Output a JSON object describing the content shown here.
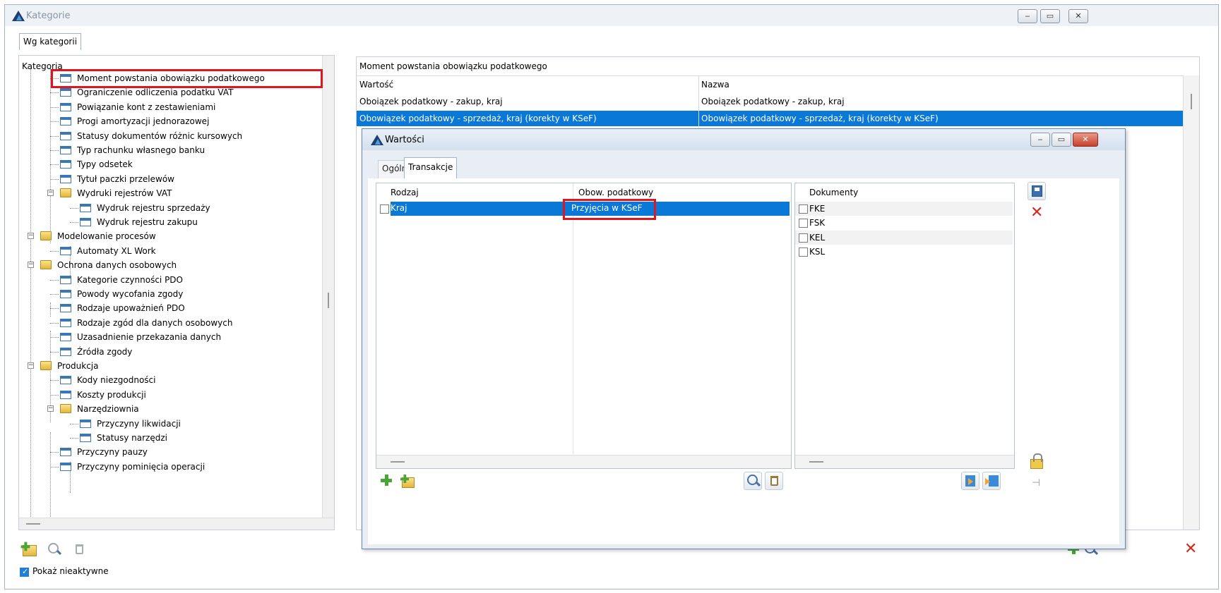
{
  "window": {
    "title": "Kategorie",
    "minimize": "‒",
    "maximize": "▭",
    "close": "✕"
  },
  "main_tab": "Wg kategorii",
  "tree": {
    "header": "Kategoria",
    "items": [
      "Moment powstania obowiązku podatkowego",
      "Ograniczenie odliczenia podatku VAT",
      "Powiązanie kont z zestawieniami",
      "Progi amortyzacji jednorazowej",
      "Statusy dokumentów różnic kursowych",
      "Typ rachunku własnego banku",
      "Typy odsetek",
      "Tytuł paczki przelewów",
      "Wydruki rejestrów VAT",
      "Wydruk rejestru sprzedaży",
      "Wydruk rejestru zakupu",
      "Modelowanie procesów",
      "Automaty XL Work",
      "Ochrona danych osobowych",
      "Kategorie czynności PDO",
      "Powody wycofania zgody",
      "Rodzaje upoważnień PDO",
      "Rodzaje zgód dla danych osobowych",
      "Uzasadnienie przekazania danych",
      "Źródła zgody",
      "Produkcja",
      "Kody niezgodności",
      "Koszty produkcji",
      "Narzędziownia",
      "Przyczyny likwidacji",
      "Statusy narzędzi",
      "Przyczyny pauzy",
      "Przyczyny pominięcia operacji"
    ]
  },
  "right_grid": {
    "title": "Moment powstania obowiązku podatkowego",
    "columns": [
      "Wartość",
      "Nazwa"
    ],
    "rows": [
      [
        "Oboiązek podatkowy - zakup, kraj",
        "Oboiązek podatkowy - zakup, kraj"
      ],
      [
        "Obowiązek podatkowy - sprzedaż, kraj (korekty w KSeF)",
        "Obowiązek podatkowy - sprzedaż, kraj (korekty w KSeF)"
      ]
    ]
  },
  "dialog": {
    "title": "Wartości",
    "tabs": [
      "Ogólne",
      "Transakcje"
    ],
    "left_columns": [
      "Rodzaj",
      "Obow. podatkowy"
    ],
    "left_rows": [
      [
        "Kraj",
        "Przyjęcia w KSeF"
      ]
    ],
    "docs_header": "Dokumenty",
    "docs": [
      "FKE",
      "FSK",
      "KEL",
      "KSL"
    ]
  },
  "footer": {
    "show_inactive": "Pokaż nieaktywne"
  },
  "colors": {
    "selection": "#0a78d7",
    "highlight": "#e0161f"
  }
}
